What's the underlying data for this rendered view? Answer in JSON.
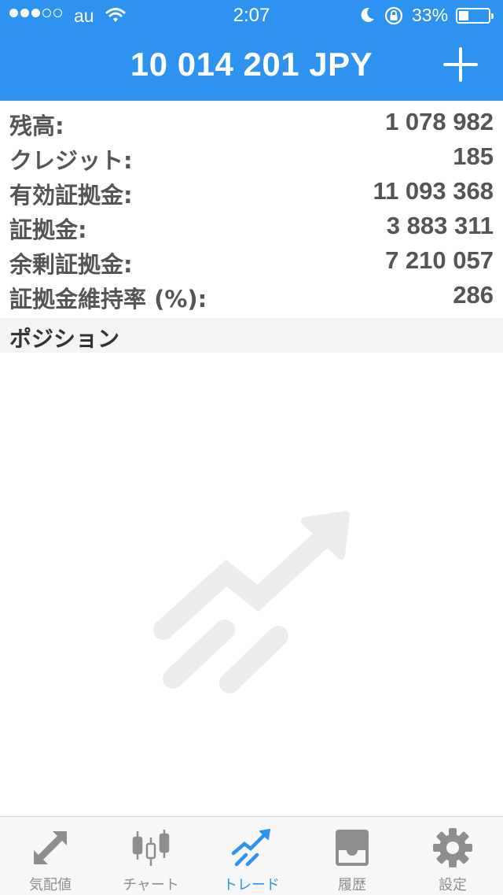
{
  "status_bar": {
    "carrier": "au",
    "time": "2:07",
    "battery_percent_label": "33%",
    "battery_level": 0.33,
    "signal_filled": 3,
    "signal_total": 5
  },
  "header": {
    "title": "10 014 201 JPY",
    "add_icon": "plus-icon"
  },
  "summary": [
    {
      "label": "残高:",
      "value": "1 078 982"
    },
    {
      "label": "クレジット:",
      "value": "185"
    },
    {
      "label": "有効証拠金:",
      "value": "11 093 368"
    },
    {
      "label": "証拠金:",
      "value": "3 883 311"
    },
    {
      "label": "余剰証拠金:",
      "value": "7 210 057"
    },
    {
      "label": "証拠金維持率 (%):",
      "value": "286"
    }
  ],
  "positions": {
    "title": "ポジション",
    "empty_icon": "trend-arrow-icon"
  },
  "tabs": [
    {
      "label": "気配値",
      "icon": "quotes-arrows-icon",
      "active": false
    },
    {
      "label": "チャート",
      "icon": "candlestick-icon",
      "active": false
    },
    {
      "label": "トレード",
      "icon": "trade-trend-icon",
      "active": true
    },
    {
      "label": "履歴",
      "icon": "inbox-tray-icon",
      "active": false
    },
    {
      "label": "設定",
      "icon": "gear-icon",
      "active": false
    }
  ],
  "colors": {
    "accent": "#2e93f0",
    "tab_inactive": "#8e8e8e",
    "text": "#555555"
  }
}
